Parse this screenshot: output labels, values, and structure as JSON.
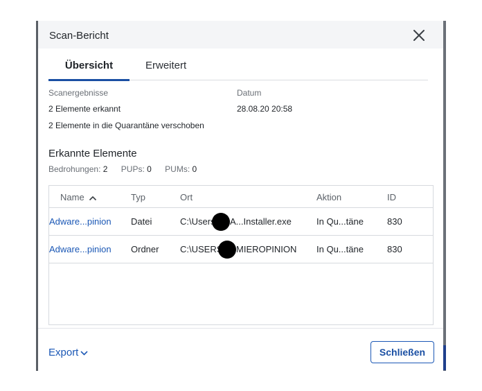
{
  "dialog": {
    "title": "Scan-Bericht"
  },
  "tabs": [
    {
      "label": "Übersicht",
      "active": true
    },
    {
      "label": "Erweitert",
      "active": false
    }
  ],
  "summary": {
    "results_label": "Scanergebnisse",
    "line1": "2 Elemente erkannt",
    "line2": "2 Elemente in die Quarantäne verschoben",
    "date_label": "Datum",
    "date_value": "28.08.20 20:58"
  },
  "detected": {
    "title": "Erkannte Elemente",
    "threats_label": "Bedrohungen:",
    "threats_value": "2",
    "pups_label": "PUPs:",
    "pups_value": "0",
    "pums_label": "PUMs:",
    "pums_value": "0"
  },
  "table": {
    "columns": [
      "Name",
      "Typ",
      "Ort",
      "Aktion",
      "ID"
    ],
    "rows": [
      {
        "name": "Adware...pinion",
        "type": "Datei",
        "location_prefix": "C:\\Users",
        "location_suffix": "A...Installer.exe",
        "action": "In Qu...täne",
        "id": "830"
      },
      {
        "name": "Adware...pinion",
        "type": "Ordner",
        "location_prefix": "C:\\USERS",
        "location_suffix": "MIEROPINION",
        "action": "In Qu...täne",
        "id": "830"
      }
    ]
  },
  "footer": {
    "export_label": "Export",
    "close_label": "Schließen"
  },
  "colors": {
    "accent": "#1a4fa3",
    "link": "#1a57b5",
    "header_bg": "#f4f5f7"
  }
}
